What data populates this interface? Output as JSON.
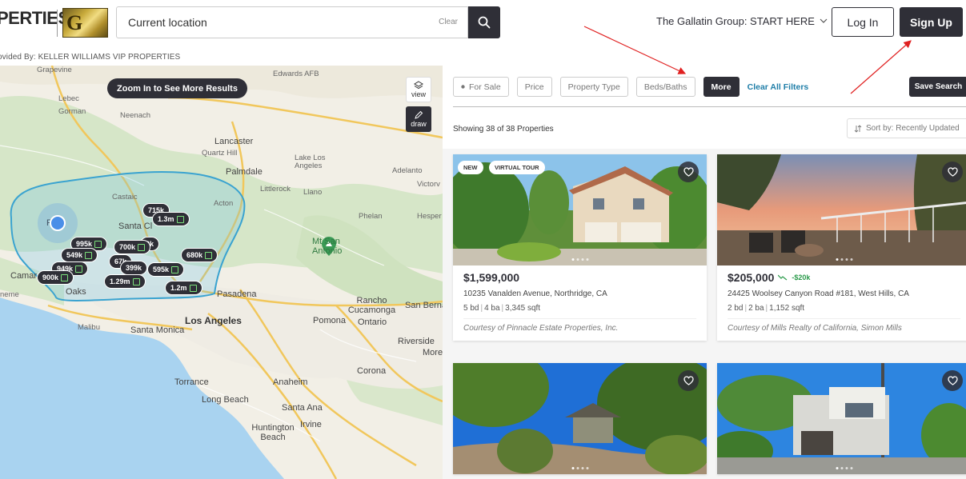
{
  "header": {
    "brand_text": "PERTIES",
    "logo_letter": "G",
    "search": {
      "value": "Current location",
      "clear_label": "Clear"
    },
    "group_menu": "The Gallatin Group: START HERE",
    "login": "Log In",
    "signup": "Sign Up",
    "provided_by": "ovided By: KELLER WILLIAMS VIP PROPERTIES"
  },
  "map": {
    "zoom_note": "Zoom In to See More Results",
    "tools": {
      "view": "view",
      "draw": "draw"
    },
    "labels": {
      "grapevine": "Grapevine",
      "edwards": "Edwards AFB",
      "lebec": "Lebec",
      "gorman": "Gorman",
      "neenach": "Neenach",
      "lancaster": "Lancaster",
      "quartz_hill": "Quartz Hill",
      "palmdale": "Palmdale",
      "lake_los_angeles": "Lake Los Angeles",
      "adelanto": "Adelanto",
      "victorville": "Victorv",
      "castaic": "Castaic",
      "littlerock": "Littlerock",
      "llano": "Llano",
      "acton": "Acton",
      "santa_clarita": "Santa Cl",
      "phelan": "Phelan",
      "hesperia": "Hesper",
      "fillmore": "Fi",
      "mt_san_antonio": "Mt San Antonio",
      "camarillo": "Camar",
      "oxnard": "neme",
      "oaks": "Oaks",
      "pasadena": "Pasadena",
      "rancho": "Rancho Cucamonga",
      "san_bern": "San Berna",
      "malibu": "Malibu",
      "santa_monica": "Santa Monica",
      "los_angeles": "Los Angeles",
      "pomona": "Pomona",
      "ontario": "Ontario",
      "riverside": "Riverside",
      "moreno": "More",
      "corona": "Corona",
      "torrance": "Torrance",
      "anaheim": "Anaheim",
      "long_beach": "Long Beach",
      "santa_ana": "Santa Ana",
      "irvine": "Irvine",
      "huntington": "Huntington Beach"
    },
    "pins": [
      "715k",
      "1.3m",
      "995k",
      "700k",
      "549k",
      "9k",
      "680k",
      "67k",
      "949k",
      "399k",
      "595k",
      "900k",
      "1.29m",
      "1.2m"
    ]
  },
  "filters": {
    "for_sale": "For Sale",
    "price": "Price",
    "property_type": "Property Type",
    "beds_baths": "Beds/Baths",
    "more": "More",
    "clear_all": "Clear All Filters",
    "save_search": "Save Search"
  },
  "results": {
    "showing": "Showing 38 of 38 Properties",
    "sort": "Sort by: Recently Updated"
  },
  "listings": [
    {
      "badge_new": "NEW",
      "badge_tour": "VIRTUAL TOUR",
      "price": "$1,599,000",
      "address": "10235 Vanalden Avenue, Northridge, CA",
      "beds": "5 bd",
      "baths": "4 ba",
      "sqft": "3,345 sqft",
      "courtesy": "Courtesy of Pinnacle Estate Properties, Inc."
    },
    {
      "price": "$205,000",
      "price_drop": "-$20k",
      "address": "24425 Woolsey Canyon Road #181, West Hills, CA",
      "beds": "2 bd",
      "baths": "2 ba",
      "sqft": "1,152 sqft",
      "courtesy": "Courtesy of Mills Realty of California, Simon Mills"
    },
    {},
    {}
  ],
  "colors": {
    "dark": "#2f2f37",
    "link": "#1f7ea8",
    "price_drop": "#2a9a4a",
    "draw_region": "#3aa3d0",
    "annotation": "#e02020"
  }
}
